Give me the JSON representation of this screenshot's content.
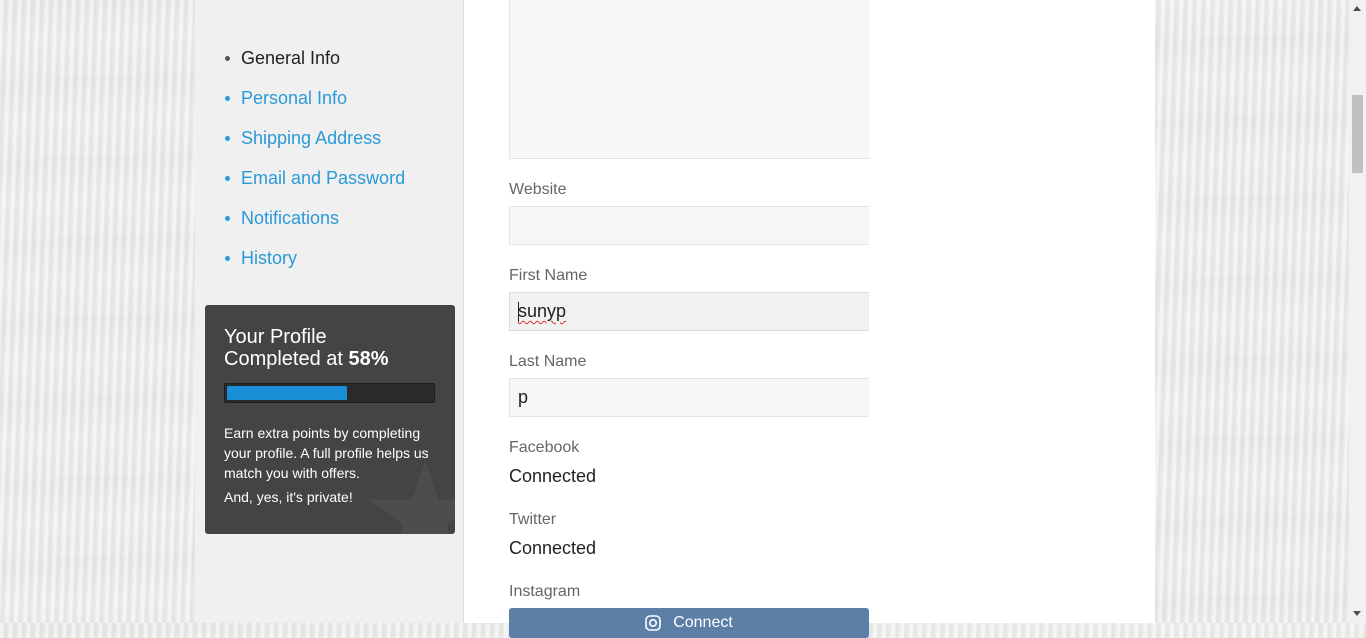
{
  "nav": {
    "items": [
      {
        "label": "General Info",
        "current": true
      },
      {
        "label": "Personal Info",
        "current": false
      },
      {
        "label": "Shipping Address",
        "current": false
      },
      {
        "label": "Email and Password",
        "current": false
      },
      {
        "label": "Notifications",
        "current": false
      },
      {
        "label": "History",
        "current": false
      }
    ]
  },
  "profile_card": {
    "title_line1": "Your Profile",
    "title_line2": "Completed at ",
    "percent_text": "58%",
    "progress": 0.58,
    "description": "Earn extra points by completing your profile. A full profile helps us match you with offers.",
    "privacy_note": "And, yes, it's private!"
  },
  "form": {
    "website": {
      "label": "Website",
      "value": ""
    },
    "first_name": {
      "label": "First Name",
      "value": "sunyp"
    },
    "last_name": {
      "label": "Last Name",
      "value": "p"
    },
    "facebook": {
      "label": "Facebook",
      "status": "Connected"
    },
    "twitter": {
      "label": "Twitter",
      "status": "Connected"
    },
    "instagram": {
      "label": "Instagram",
      "button_label": "Connect"
    }
  },
  "colors": {
    "link": "#2b9ad8",
    "progress": "#1a8fd8",
    "card_bg": "#444444",
    "instagram_button": "#5b7fa6"
  }
}
